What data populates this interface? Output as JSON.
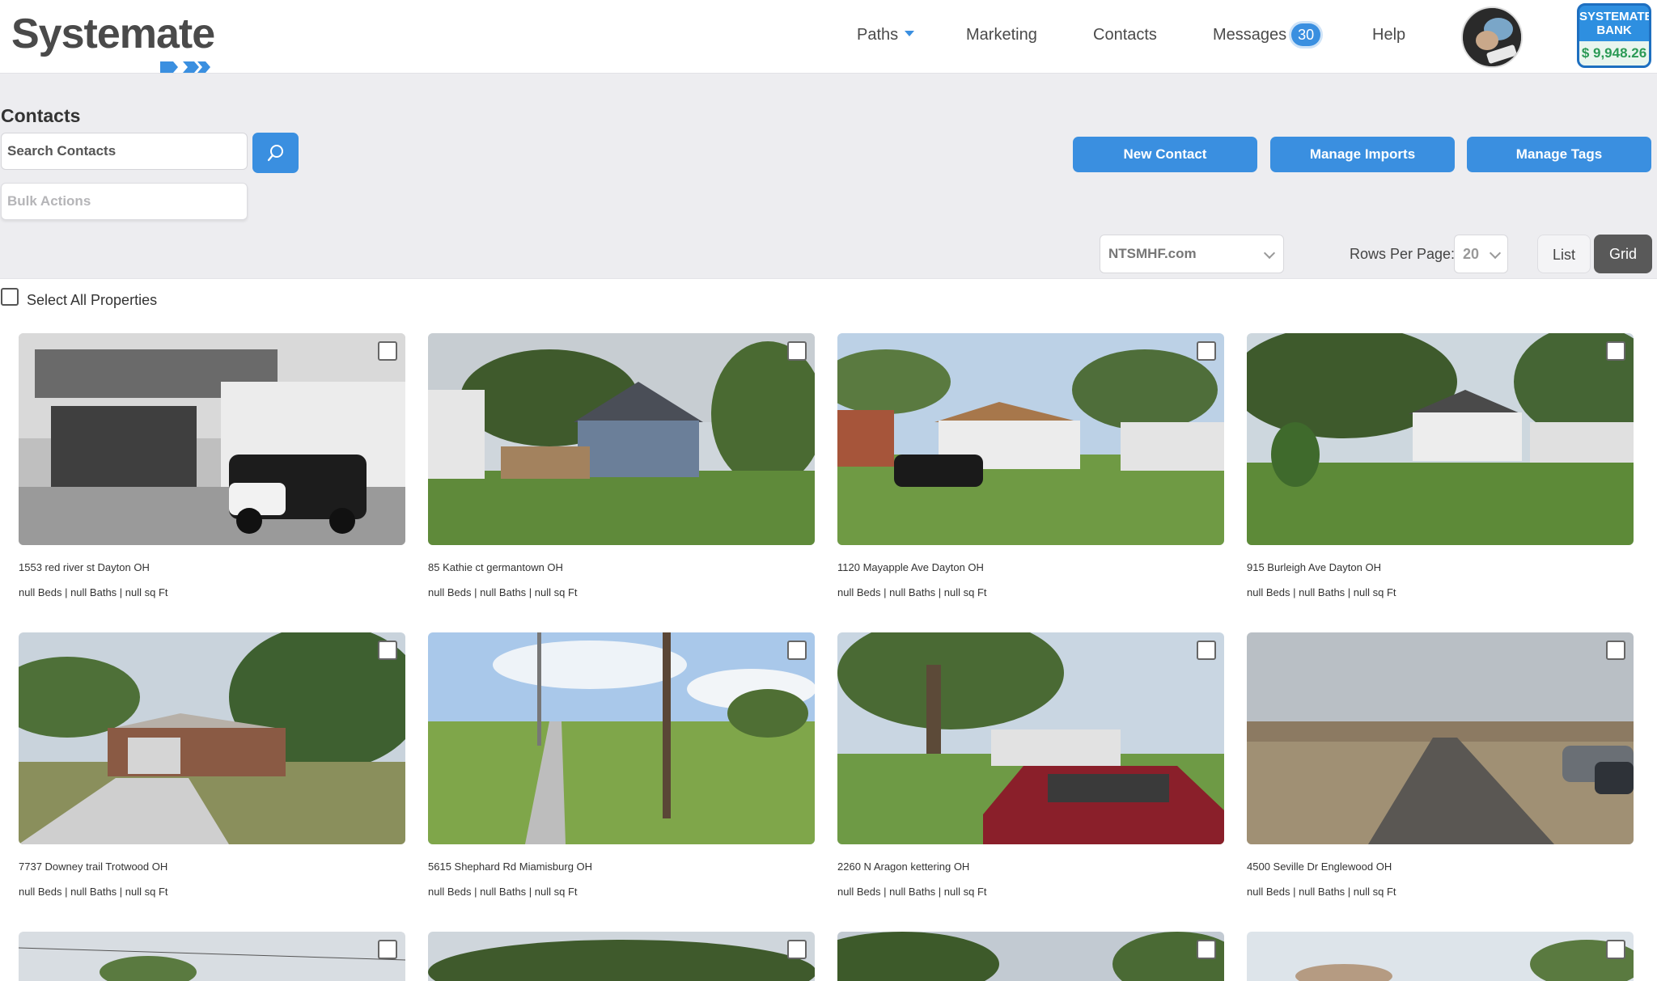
{
  "app": {
    "logo_text": "Systemate"
  },
  "nav": {
    "paths": "Paths",
    "marketing": "Marketing",
    "contacts": "Contacts",
    "messages": "Messages",
    "messages_count": "30",
    "help": "Help"
  },
  "bank": {
    "title": "SYSTEMATE BANK",
    "amount": "$ 9,948.26"
  },
  "page": {
    "title": "Contacts"
  },
  "search": {
    "placeholder": "Search Contacts"
  },
  "bulk": {
    "label": "Bulk Actions"
  },
  "actions": {
    "new_contact": "New Contact",
    "manage_imports": "Manage Imports",
    "manage_tags": "Manage Tags"
  },
  "filters": {
    "domain": "NTSMHF.com",
    "rows_label": "Rows Per Page:",
    "rows_value": "20",
    "view_list": "List",
    "view_grid": "Grid"
  },
  "selection": {
    "select_all": "Select All Properties"
  },
  "colors": {
    "accent": "#3a8fe0",
    "grid_active": "#595959"
  },
  "properties": [
    {
      "address": "1553 red river st Dayton OH",
      "specs": "null Beds | null Baths | null sq Ft"
    },
    {
      "address": "85 Kathie ct germantown OH",
      "specs": "null Beds | null Baths | null sq Ft"
    },
    {
      "address": "1120 Mayapple Ave Dayton OH",
      "specs": "null Beds | null Baths | null sq Ft"
    },
    {
      "address": "915 Burleigh Ave Dayton OH",
      "specs": "null Beds | null Baths | null sq Ft"
    },
    {
      "address": "7737 Downey trail Trotwood OH",
      "specs": "null Beds | null Baths | null sq Ft"
    },
    {
      "address": "5615 Shephard Rd Miamisburg OH",
      "specs": "null Beds | null Baths | null sq Ft"
    },
    {
      "address": "2260 N Aragon kettering OH",
      "specs": "null Beds | null Baths | null sq Ft"
    },
    {
      "address": "4500 Seville Dr Englewood OH",
      "specs": "null Beds | null Baths | null sq Ft"
    }
  ]
}
